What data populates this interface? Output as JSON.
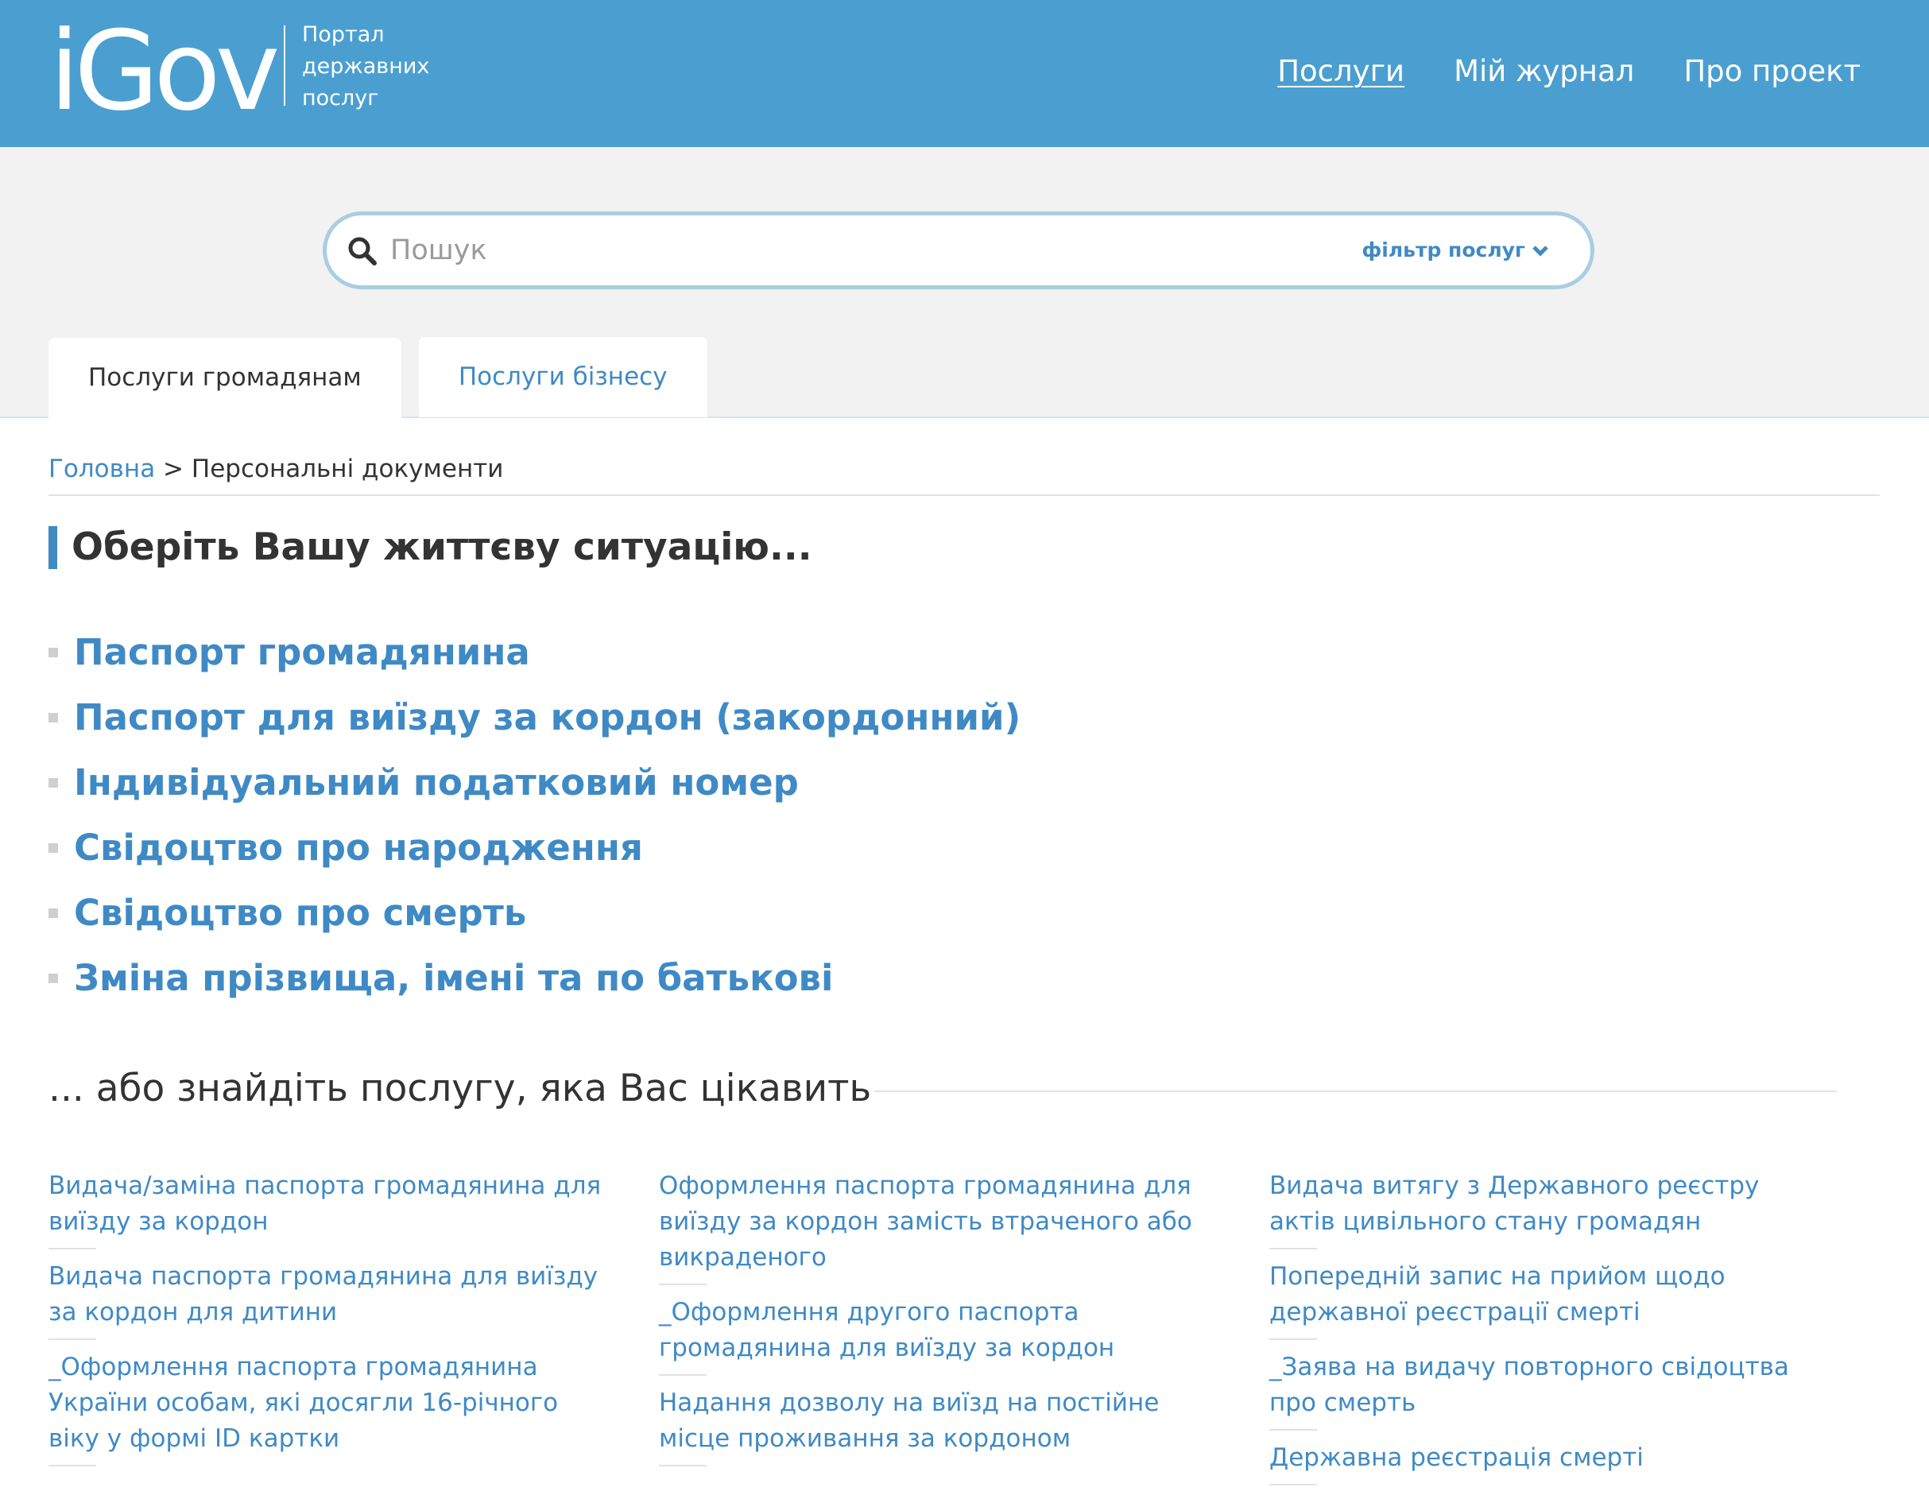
{
  "header": {
    "logo": "iGov",
    "logo_sub": [
      "Портал",
      "державних",
      "послуг"
    ],
    "nav": [
      {
        "label": "Послуги",
        "active": true
      },
      {
        "label": "Мій журнал",
        "active": false
      },
      {
        "label": "Про проект",
        "active": false
      }
    ],
    "accent_color": "#4a9fd0"
  },
  "search": {
    "placeholder": "Пошук",
    "value": "",
    "filter_label": "фільтр послуг"
  },
  "tabs": [
    {
      "label": "Послуги громадянам",
      "active": true
    },
    {
      "label": "Послуги бізнесу",
      "active": false
    }
  ],
  "breadcrumb": {
    "home": "Головна",
    "separator": ">",
    "current": "Персональні документи"
  },
  "situation_title": "Оберіть Вашу життєву ситуацію...",
  "situations": [
    "Паспорт громадянина",
    "Паспорт для виїзду за кордон (закордонний)",
    "Індивідуальний податковий номер",
    "Свідоцтво про народження",
    "Свідоцтво про смерть",
    "Зміна прізвища, імені та по батькові"
  ],
  "find_heading": "... або знайдіть послугу, яка Вас цікавить",
  "services": [
    [
      "Видача/заміна паспорта громадянина для виїзду за кордон",
      "Видача паспорта громадянина для виїзду за кордон для дитини",
      "_Оформлення паспорта громадянина України особам, які досягли 16-річного віку у формі ID картки"
    ],
    [
      "Оформлення паспорта громадянина для виїзду за кордон замість втраченого або викраденого",
      "_Оформлення другого паспорта громадянина для виїзду за кордон",
      "Надання дозволу на виїзд на постійне місце проживання за кордоном"
    ],
    [
      "Видача витягу з Державного реєстру актів цивільного стану громадян",
      "Попередній запис на прийом щодо державної реєстрації смерті",
      "_Заява на видачу повторного свідоцтва про смерть",
      "Державна реєстрація смерті"
    ]
  ]
}
